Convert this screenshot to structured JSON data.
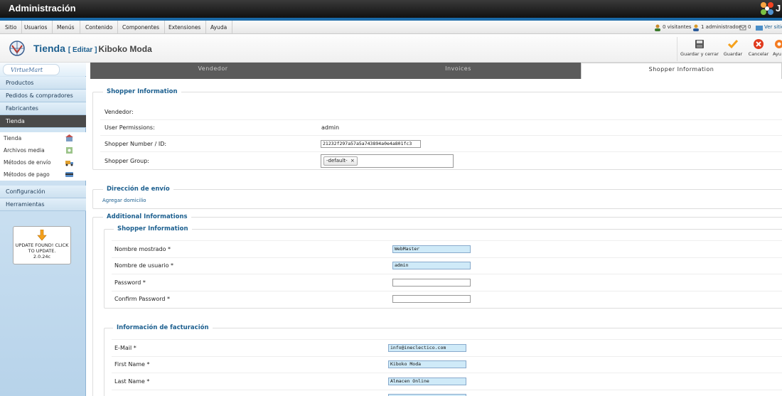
{
  "app": {
    "title": "Administración",
    "corner_text": "J"
  },
  "menu": {
    "items": [
      {
        "label": "Sitio"
      },
      {
        "label": "Usuarios"
      },
      {
        "label": "Menús"
      },
      {
        "label": "Contenido"
      },
      {
        "label": "Componentes"
      },
      {
        "label": "Extensiones"
      },
      {
        "label": "Ayuda"
      }
    ],
    "status": {
      "visitors": "0 visitantes",
      "admins": "1 administrador",
      "messages": "0",
      "view_site": "Ver sitio"
    }
  },
  "header": {
    "title": "Tienda",
    "edit_label": "[ Editar ]",
    "store_name": "Kiboko Moda",
    "toolbar": {
      "save_close": "Guardar y cerrar",
      "save": "Guardar",
      "cancel": "Cancelar",
      "help": "Ayu"
    }
  },
  "sidebar": {
    "logo_text": "VirtueMart",
    "top_items": [
      {
        "label": "Productos"
      },
      {
        "label": "Pedidos & compradores"
      },
      {
        "label": "Fabricantes"
      },
      {
        "label": "Tienda"
      }
    ],
    "sub_items": [
      {
        "label": "Tienda",
        "icon": "store-icon"
      },
      {
        "label": "Archivos media",
        "icon": "media-icon"
      },
      {
        "label": "Métodos de envío",
        "icon": "truck-icon"
      },
      {
        "label": "Métodos de pago",
        "icon": "payment-icon"
      }
    ],
    "bottom_items": [
      {
        "label": "Configuración"
      },
      {
        "label": "Herramientas"
      }
    ],
    "update_box": {
      "line1": "UPDATE FOUND! CLICK",
      "line2": "TO UPDATE.",
      "version": "2.0.24c"
    }
  },
  "tabs": [
    {
      "label": "Vendedor",
      "active": false
    },
    {
      "label": "Invoices",
      "active": false
    },
    {
      "label": "Shopper Information",
      "active": true
    }
  ],
  "shopper_info": {
    "legend": "Shopper Information",
    "vendor_label": "Vendedor:",
    "permissions_label": "User Permissions:",
    "permissions_value": "admin",
    "number_label": "Shopper Number / ID:",
    "number_value": "21232f297a57a5a743894a0e4a801fc3",
    "group_label": "Shopper Group:",
    "group_chip": "-default-",
    "chip_remove": "×"
  },
  "shipping": {
    "legend": "Dirección de envío",
    "add_link": "Agregar domicilio"
  },
  "additional": {
    "legend": "Additional Informations",
    "shopper_legend": "Shopper Information",
    "fields": [
      {
        "label": "Nombre mostrado *",
        "value": "WebMaster"
      },
      {
        "label": "Nombre de usuario *",
        "value": "admin"
      },
      {
        "label": "Password *",
        "value": ""
      },
      {
        "label": "Confirm Password *",
        "value": ""
      }
    ],
    "billing_legend": "Información de facturación",
    "billing_fields": [
      {
        "label": "E-Mail *",
        "value": "info@ineclectico.com"
      },
      {
        "label": "First Name *",
        "value": "Kiboko Moda"
      },
      {
        "label": "Last Name *",
        "value": "Almacen Online"
      }
    ]
  }
}
